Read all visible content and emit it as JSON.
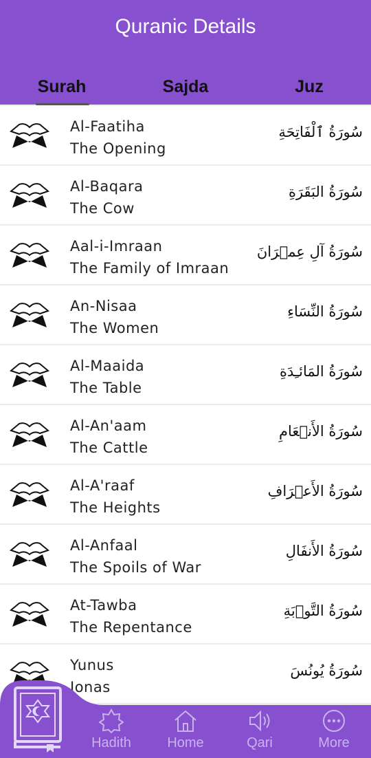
{
  "header": {
    "title": "Quranic Details"
  },
  "tabs": [
    {
      "label": "Surah",
      "active": true
    },
    {
      "label": "Sajda",
      "active": false
    },
    {
      "label": "Juz",
      "active": false
    }
  ],
  "surahs": [
    {
      "english": "Al-Faatiha",
      "meaning": "The Opening",
      "arabic": "سُورَةُ ٱلْفَاتِحَةِ"
    },
    {
      "english": "Al-Baqara",
      "meaning": "The Cow",
      "arabic": "سُورَةُ البَقَرَةِ"
    },
    {
      "english": "Aal-i-Imraan",
      "meaning": "The Family of Imraan",
      "arabic": "سُورَةُ آلِ عِمۡرَانَ"
    },
    {
      "english": "An-Nisaa",
      "meaning": "The Women",
      "arabic": "سُورَةُ النِّسَاءِ"
    },
    {
      "english": "Al-Maaida",
      "meaning": "The Table",
      "arabic": "سُورَةُ المَائـِدَةِ"
    },
    {
      "english": "Al-An'aam",
      "meaning": "The Cattle",
      "arabic": "سُورَةُ الأَنۡعَامِ"
    },
    {
      "english": "Al-A'raaf",
      "meaning": "The Heights",
      "arabic": "سُورَةُ الأَعۡرَافِ"
    },
    {
      "english": "Al-Anfaal",
      "meaning": "The Spoils of War",
      "arabic": "سُورَةُ الأَنفَالِ"
    },
    {
      "english": "At-Tawba",
      "meaning": "The Repentance",
      "arabic": "سُورَةُ التَّوۡبَةِ"
    },
    {
      "english": "Yunus",
      "meaning": "Jonas",
      "arabic": "سُورَةُ يُونُسَ"
    }
  ],
  "nav": [
    {
      "label": "Hadith",
      "icon": "star-icon"
    },
    {
      "label": "Home",
      "icon": "home-icon"
    },
    {
      "label": "Qari",
      "icon": "speaker-icon"
    },
    {
      "label": "More",
      "icon": "more-icon"
    }
  ],
  "colors": {
    "primary": "#8650cf",
    "nav_label": "#c9b3ee"
  }
}
